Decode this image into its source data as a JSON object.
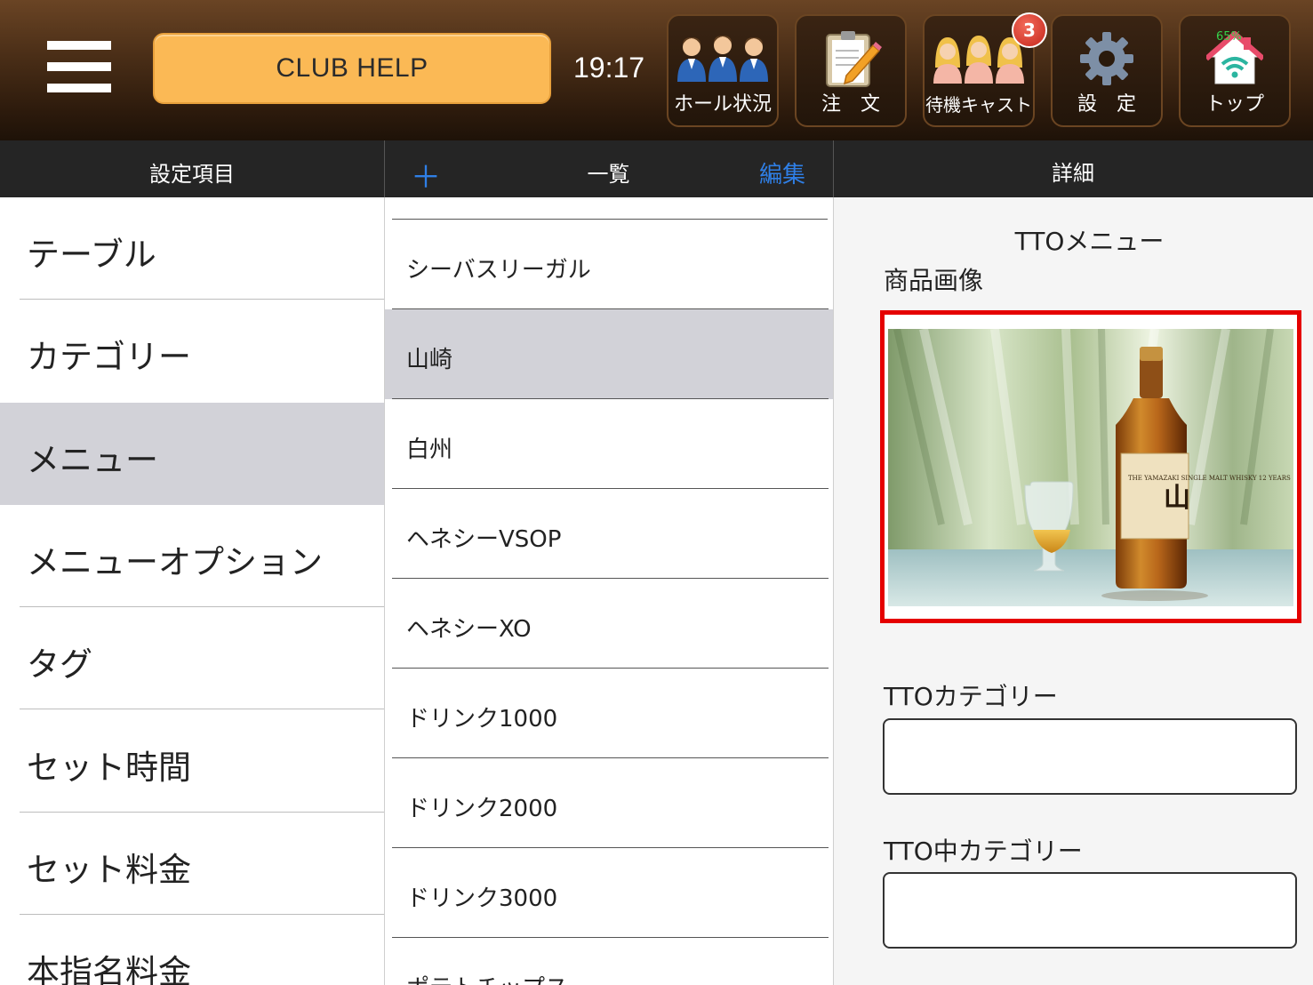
{
  "header": {
    "club_help_label": "CLUB HELP",
    "time": "19:17",
    "buttons": [
      {
        "label": "ホール状況",
        "icon": "staff-group-icon"
      },
      {
        "label": "注　文",
        "icon": "order-clipboard-icon"
      },
      {
        "label": "待機キャスト",
        "icon": "cast-group-icon",
        "badge": "3"
      },
      {
        "label": "設　定",
        "icon": "gear-icon"
      },
      {
        "label": "トップ",
        "icon": "home-wifi-icon",
        "battery": "65%"
      }
    ]
  },
  "columns": {
    "left_title": "設定項目",
    "mid_title": "一覧",
    "mid_add": "＋",
    "mid_edit": "編集",
    "right_title": "詳細"
  },
  "settings_items": [
    {
      "label": "テーブル"
    },
    {
      "label": "カテゴリー"
    },
    {
      "label": "メニュー",
      "selected": true
    },
    {
      "label": "メニューオプション"
    },
    {
      "label": "タグ"
    },
    {
      "label": "セット時間"
    },
    {
      "label": "セット料金"
    },
    {
      "label": "本指名料金"
    }
  ],
  "menu_items": [
    {
      "label": "シーバスリーガル"
    },
    {
      "label": "山崎",
      "selected": true
    },
    {
      "label": "白州"
    },
    {
      "label": "ヘネシーVSOP"
    },
    {
      "label": "ヘネシーXO"
    },
    {
      "label": "ドリンク1000"
    },
    {
      "label": "ドリンク2000"
    },
    {
      "label": "ドリンク3000"
    },
    {
      "label": "ポテトチップス"
    }
  ],
  "detail": {
    "section_title": "TTOメニュー",
    "image_label": "商品画像",
    "image_bottle_text": "THE YAMAZAKI SINGLE MALT WHISKY 12 YEARS",
    "category_label": "TTOカテゴリー",
    "category_value": "",
    "mid_category_label": "TTO中カテゴリー",
    "mid_category_value": ""
  },
  "colors": {
    "accent_blue": "#2f7fe6",
    "club_help_bg": "#fbb955",
    "selected_bg": "#d2d2d8",
    "highlight_red": "#e50000",
    "badge_red": "#c5261b"
  }
}
